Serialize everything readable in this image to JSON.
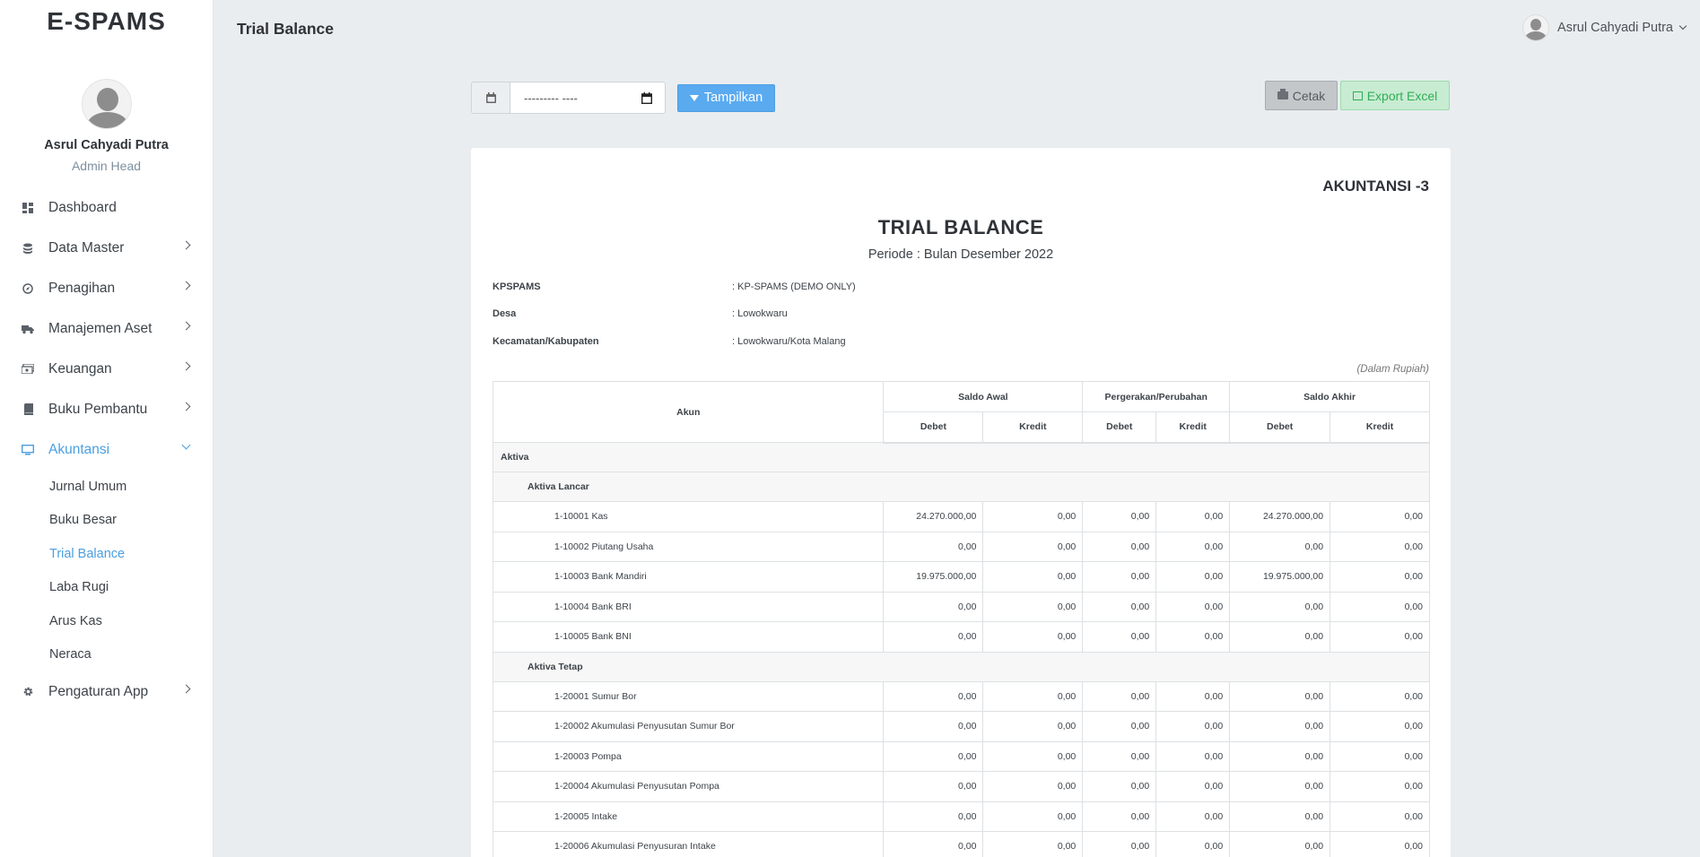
{
  "brand": "E-SPAMS",
  "profile": {
    "name": "Asrul Cahyadi Putra",
    "role": "Admin Head"
  },
  "menu": [
    {
      "label": "Dashboard",
      "icon": "dashboard-icon"
    },
    {
      "label": "Data Master",
      "icon": "database-icon"
    },
    {
      "label": "Penagihan",
      "icon": "compass-icon"
    },
    {
      "label": "Manajemen Aset",
      "icon": "truck-icon"
    },
    {
      "label": "Keuangan",
      "icon": "money-icon"
    },
    {
      "label": "Buku Pembantu",
      "icon": "book-icon"
    },
    {
      "label": "Akuntansi",
      "icon": "monitor-icon"
    },
    {
      "label": "Pengaturan App",
      "icon": "gear-icon"
    }
  ],
  "submenu": [
    "Jurnal Umum",
    "Buku Besar",
    "Trial Balance",
    "Laba Rugi",
    "Arus Kas",
    "Neraca"
  ],
  "header": {
    "title": "Trial Balance",
    "user": "Asrul Cahyadi Putra"
  },
  "filter": {
    "date_placeholder": "--------- ----",
    "show_label": "Tampilkan"
  },
  "actions": {
    "print_label": "Cetak",
    "export_label": "Export Excel"
  },
  "report": {
    "code": "AKUNTANSI -3",
    "title": "TRIAL BALANCE",
    "period": "Periode : Bulan Desember 2022",
    "info": [
      {
        "label": "KPSPAMS",
        "value": ": KP-SPAMS (DEMO ONLY)"
      },
      {
        "label": "Desa",
        "value": ": Lowokwaru"
      },
      {
        "label": "Kecamatan/Kabupaten",
        "value": ": Lowokwaru/Kota Malang"
      }
    ],
    "unit": "(Dalam Rupiah)",
    "columns": {
      "account": "Akun",
      "groups": [
        "Saldo Awal",
        "Pergerakan/Perubahan",
        "Saldo Akhir"
      ],
      "debit": "Debet",
      "credit": "Kredit"
    },
    "group": "Aktiva",
    "sections": [
      {
        "name": "Aktiva Lancar",
        "rows": [
          {
            "account": "1-10001 Kas",
            "values": [
              "24.270.000,00",
              "0,00",
              "0,00",
              "0,00",
              "24.270.000,00",
              "0,00"
            ]
          },
          {
            "account": "1-10002 Piutang Usaha",
            "values": [
              "0,00",
              "0,00",
              "0,00",
              "0,00",
              "0,00",
              "0,00"
            ]
          },
          {
            "account": "1-10003 Bank Mandiri",
            "values": [
              "19.975.000,00",
              "0,00",
              "0,00",
              "0,00",
              "19.975.000,00",
              "0,00"
            ]
          },
          {
            "account": "1-10004 Bank BRI",
            "values": [
              "0,00",
              "0,00",
              "0,00",
              "0,00",
              "0,00",
              "0,00"
            ]
          },
          {
            "account": "1-10005 Bank BNI",
            "values": [
              "0,00",
              "0,00",
              "0,00",
              "0,00",
              "0,00",
              "0,00"
            ]
          }
        ]
      },
      {
        "name": "Aktiva Tetap",
        "rows": [
          {
            "account": "1-20001 Sumur Bor",
            "values": [
              "0,00",
              "0,00",
              "0,00",
              "0,00",
              "0,00",
              "0,00"
            ]
          },
          {
            "account": "1-20002 Akumulasi Penyusutan Sumur Bor",
            "values": [
              "0,00",
              "0,00",
              "0,00",
              "0,00",
              "0,00",
              "0,00"
            ]
          },
          {
            "account": "1-20003 Pompa",
            "values": [
              "0,00",
              "0,00",
              "0,00",
              "0,00",
              "0,00",
              "0,00"
            ]
          },
          {
            "account": "1-20004 Akumulasi Penyusutan Pompa",
            "values": [
              "0,00",
              "0,00",
              "0,00",
              "0,00",
              "0,00",
              "0,00"
            ]
          },
          {
            "account": "1-20005 Intake",
            "values": [
              "0,00",
              "0,00",
              "0,00",
              "0,00",
              "0,00",
              "0,00"
            ]
          },
          {
            "account": "1-20006 Akumulasi Penyusuran Intake",
            "values": [
              "0,00",
              "0,00",
              "0,00",
              "0,00",
              "0,00",
              "0,00"
            ]
          }
        ]
      }
    ]
  }
}
